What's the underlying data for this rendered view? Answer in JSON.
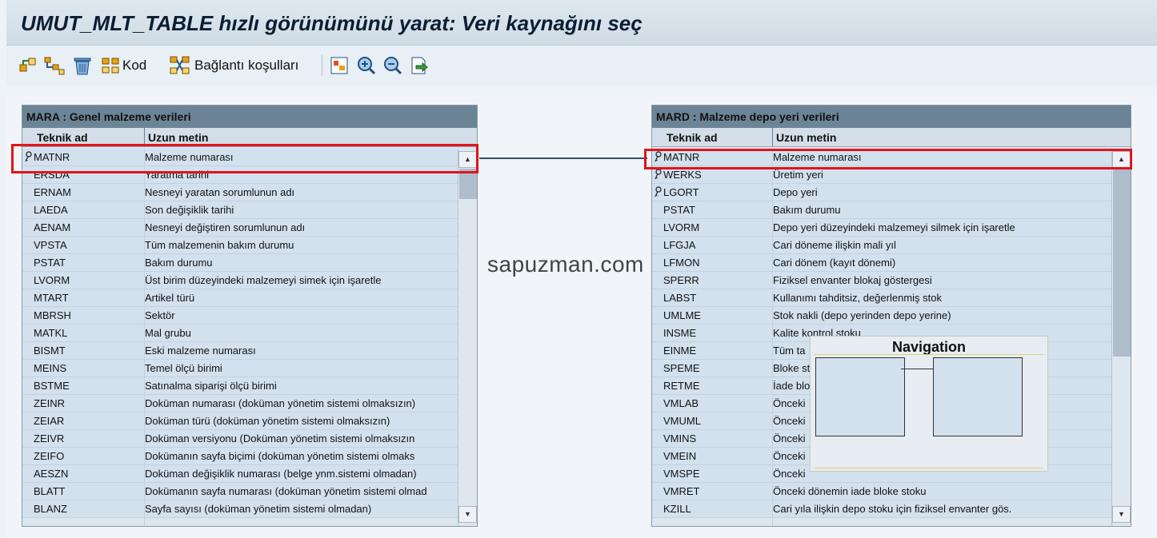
{
  "window": {
    "title": "UMUT_MLT_TABLE hızlı görünümünü yarat: Veri kaynağını seç"
  },
  "toolbar": {
    "code_label": "Kod",
    "join_label": "Bağlantı koşulları"
  },
  "left_table": {
    "title": "MARA : Genel malzeme verileri",
    "col_technical": "Teknik ad",
    "col_long_text": "Uzun metin",
    "rows": [
      {
        "name": "MATNR",
        "text": "Malzeme numarası",
        "key": true
      },
      {
        "name": "ERSDA",
        "text": "Yaratma tarihi",
        "key": false
      },
      {
        "name": "ERNAM",
        "text": "Nesneyi yaratan sorumlunun adı",
        "key": false
      },
      {
        "name": "LAEDA",
        "text": "Son değişiklik tarihi",
        "key": false
      },
      {
        "name": "AENAM",
        "text": "Nesneyi değiştiren sorumlunun adı",
        "key": false
      },
      {
        "name": "VPSTA",
        "text": "Tüm malzemenin bakım durumu",
        "key": false
      },
      {
        "name": "PSTAT",
        "text": "Bakım durumu",
        "key": false
      },
      {
        "name": "LVORM",
        "text": "Üst birim düzeyindeki malzemeyi simek için işaretle",
        "key": false
      },
      {
        "name": "MTART",
        "text": "Artikel türü",
        "key": false
      },
      {
        "name": "MBRSH",
        "text": "Sektör",
        "key": false
      },
      {
        "name": "MATKL",
        "text": "Mal grubu",
        "key": false
      },
      {
        "name": "BISMT",
        "text": "Eski malzeme numarası",
        "key": false
      },
      {
        "name": "MEINS",
        "text": "Temel ölçü birimi",
        "key": false
      },
      {
        "name": "BSTME",
        "text": "Satınalma siparişi ölçü birimi",
        "key": false
      },
      {
        "name": "ZEINR",
        "text": "Doküman numarası (doküman yönetim sistemi olmaksızın)",
        "key": false
      },
      {
        "name": "ZEIAR",
        "text": "Doküman türü (doküman yönetim sistemi olmaksızın)",
        "key": false
      },
      {
        "name": "ZEIVR",
        "text": "Doküman versiyonu (Doküman yönetim sistemi olmaksızın",
        "key": false
      },
      {
        "name": "ZEIFO",
        "text": "Dokümanın sayfa biçimi (doküman yönetim sistemi olmaks",
        "key": false
      },
      {
        "name": "AESZN",
        "text": "Doküman değişiklik numarası (belge ynm.sistemi olmadan)",
        "key": false
      },
      {
        "name": "BLATT",
        "text": "Dokümanın sayfa numarası (doküman yönetim sistemi olmad",
        "key": false
      },
      {
        "name": "BLANZ",
        "text": "Sayfa sayısı (doküman yönetim sistemi olmadan)",
        "key": false
      }
    ]
  },
  "right_table": {
    "title": "MARD : Malzeme depo yeri verileri",
    "col_technical": "Teknik ad",
    "col_long_text": "Uzun metin",
    "rows": [
      {
        "name": "MATNR",
        "text": "Malzeme numarası",
        "key": true
      },
      {
        "name": "WERKS",
        "text": "Üretim yeri",
        "key": true
      },
      {
        "name": "LGORT",
        "text": "Depo yeri",
        "key": true
      },
      {
        "name": "PSTAT",
        "text": "Bakım durumu",
        "key": false
      },
      {
        "name": "LVORM",
        "text": "Depo yeri düzeyindeki malzemeyi silmek için işaretle",
        "key": false
      },
      {
        "name": "LFGJA",
        "text": "Cari döneme ilişkin mali yıl",
        "key": false
      },
      {
        "name": "LFMON",
        "text": "Cari dönem (kayıt dönemi)",
        "key": false
      },
      {
        "name": "SPERR",
        "text": "Fiziksel envanter blokaj göstergesi",
        "key": false
      },
      {
        "name": "LABST",
        "text": "Kullanımı tahditsiz, değerlenmiş stok",
        "key": false
      },
      {
        "name": "UMLME",
        "text": "Stok nakli (depo yerinden depo yerine)",
        "key": false
      },
      {
        "name": "INSME",
        "text": "Kalite kontrol stoku",
        "key": false
      },
      {
        "name": "EINME",
        "text": "Tüm ta",
        "key": false
      },
      {
        "name": "SPEME",
        "text": "Bloke st",
        "key": false
      },
      {
        "name": "RETME",
        "text": "İade blo",
        "key": false
      },
      {
        "name": "VMLAB",
        "text": "Önceki",
        "key": false
      },
      {
        "name": "VMUML",
        "text": "Önceki",
        "key": false
      },
      {
        "name": "VMINS",
        "text": "Önceki",
        "key": false
      },
      {
        "name": "VMEIN",
        "text": "Önceki",
        "key": false
      },
      {
        "name": "VMSPE",
        "text": "Önceki",
        "key": false
      },
      {
        "name": "VMRET",
        "text": "Önceki dönemin iade bloke stoku",
        "key": false
      },
      {
        "name": "KZILL",
        "text": "Cari yıla ilişkin depo stoku için fiziksel envanter gös.",
        "key": false
      }
    ]
  },
  "navigation": {
    "title": "Navigation"
  },
  "watermark": "sapuzman.com",
  "colors": {
    "highlight": "#e0141b",
    "header": "#6b8496",
    "row": "#d3e1ee"
  }
}
